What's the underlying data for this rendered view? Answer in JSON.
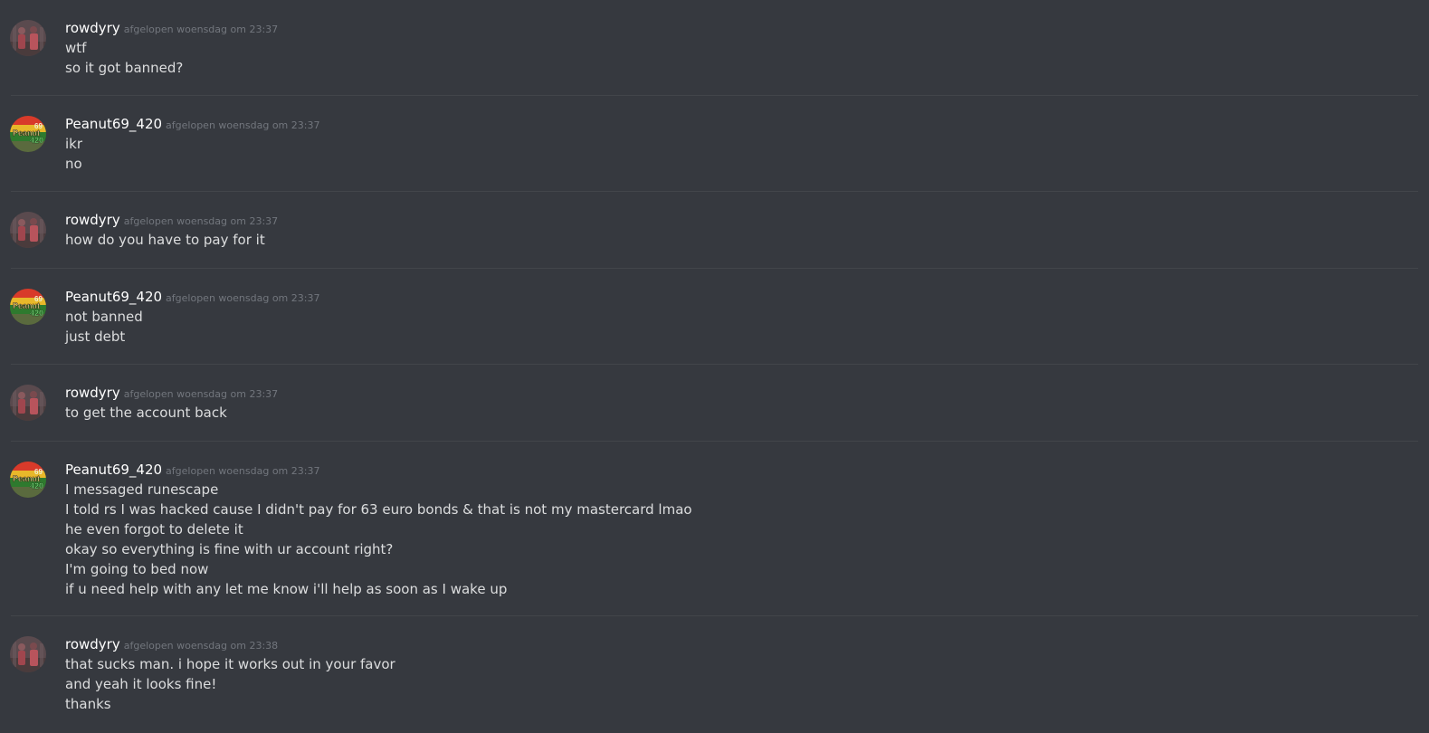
{
  "messages": [
    {
      "author": "rowdyry",
      "timestamp": "afgelopen woensdag om 23:37",
      "avatar": "rowdyry-avatar",
      "lines": [
        "wtf",
        "so it got banned?"
      ]
    },
    {
      "author": "Peanut69_420",
      "timestamp": "afgelopen woensdag om 23:37",
      "avatar": "peanut-avatar",
      "lines": [
        "ikr",
        "no"
      ]
    },
    {
      "author": "rowdyry",
      "timestamp": "afgelopen woensdag om 23:37",
      "avatar": "rowdyry-avatar",
      "lines": [
        "how do you have to pay for it"
      ]
    },
    {
      "author": "Peanut69_420",
      "timestamp": "afgelopen woensdag om 23:37",
      "avatar": "peanut-avatar",
      "lines": [
        "not banned",
        "just debt"
      ]
    },
    {
      "author": "rowdyry",
      "timestamp": "afgelopen woensdag om 23:37",
      "avatar": "rowdyry-avatar",
      "lines": [
        "to get the account back"
      ]
    },
    {
      "author": "Peanut69_420",
      "timestamp": "afgelopen woensdag om 23:37",
      "avatar": "peanut-avatar",
      "lines": [
        "I messaged runescape",
        "I told rs I was hacked cause I didn't pay for 63 euro bonds & that is not my mastercard lmao",
        "he even forgot to delete it",
        "okay so everything is fine with ur account right?",
        "I'm going to bed now",
        "if u need help with any let me know i'll help as soon as I wake up"
      ]
    },
    {
      "author": "rowdyry",
      "timestamp": "afgelopen woensdag om 23:38",
      "avatar": "rowdyry-avatar",
      "lines": [
        "that sucks man. i hope it works out in your favor",
        "and yeah it looks fine!",
        "thanks"
      ]
    }
  ],
  "avatar_text": {
    "peanut": [
      "Peanut",
      "69",
      "420"
    ]
  },
  "colors": {
    "background": "#36393f",
    "username": "#ffffff",
    "timestamp": "#72767d",
    "message_text": "#dcddde",
    "divider": "#42454a"
  }
}
